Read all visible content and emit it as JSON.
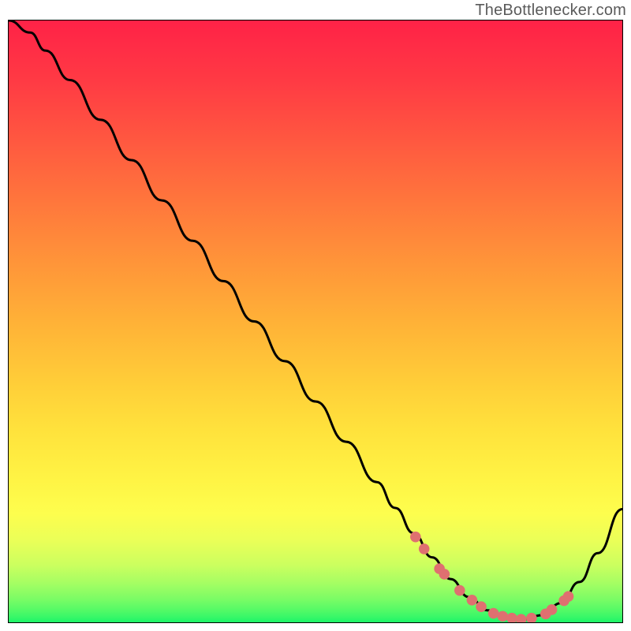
{
  "watermark": "TheBottlenecker.com",
  "gradient": {
    "stops": [
      {
        "offset": 0.0,
        "color": "#ff2247"
      },
      {
        "offset": 0.1,
        "color": "#ff3a44"
      },
      {
        "offset": 0.2,
        "color": "#ff5840"
      },
      {
        "offset": 0.3,
        "color": "#ff763c"
      },
      {
        "offset": 0.4,
        "color": "#ff9439"
      },
      {
        "offset": 0.5,
        "color": "#ffb137"
      },
      {
        "offset": 0.6,
        "color": "#ffcd38"
      },
      {
        "offset": 0.68,
        "color": "#ffe23c"
      },
      {
        "offset": 0.76,
        "color": "#fff344"
      },
      {
        "offset": 0.82,
        "color": "#fdfe4e"
      },
      {
        "offset": 0.865,
        "color": "#eaff58"
      },
      {
        "offset": 0.905,
        "color": "#cbff5f"
      },
      {
        "offset": 0.935,
        "color": "#a5fe63"
      },
      {
        "offset": 0.96,
        "color": "#7dfc65"
      },
      {
        "offset": 0.978,
        "color": "#58fa66"
      },
      {
        "offset": 0.992,
        "color": "#36f768"
      },
      {
        "offset": 1.0,
        "color": "#1cf468"
      }
    ]
  },
  "chart_data": {
    "type": "line",
    "title": "",
    "xlabel": "",
    "ylabel": "",
    "xlim": [
      0,
      100
    ],
    "ylim": [
      0,
      100
    ],
    "series": [
      {
        "name": "bottleneck-curve",
        "x": [
          0,
          3.5,
          6,
          10,
          15,
          20,
          25,
          30,
          35,
          40,
          45,
          50,
          55,
          60,
          63,
          66,
          69,
          72,
          75,
          78,
          81,
          84,
          87,
          90,
          93,
          96,
          100
        ],
        "y": [
          100,
          98.0,
          95.0,
          90.1,
          83.5,
          76.8,
          70.1,
          63.4,
          56.7,
          50.0,
          43.4,
          36.7,
          30.0,
          23.3,
          19.0,
          14.8,
          10.8,
          7.2,
          4.2,
          2.0,
          0.8,
          0.5,
          1.2,
          3.2,
          6.7,
          11.5,
          18.8
        ]
      }
    ],
    "markers": {
      "name": "optimum-points",
      "color": "#df7070",
      "points": [
        {
          "x": 66.3,
          "y": 14.2
        },
        {
          "x": 67.7,
          "y": 12.2
        },
        {
          "x": 70.2,
          "y": 8.9
        },
        {
          "x": 71.0,
          "y": 8.0
        },
        {
          "x": 73.5,
          "y": 5.3
        },
        {
          "x": 75.5,
          "y": 3.7
        },
        {
          "x": 77.0,
          "y": 2.6
        },
        {
          "x": 79.0,
          "y": 1.5
        },
        {
          "x": 80.5,
          "y": 1.0
        },
        {
          "x": 82.0,
          "y": 0.7
        },
        {
          "x": 83.5,
          "y": 0.5
        },
        {
          "x": 85.2,
          "y": 0.7
        },
        {
          "x": 87.5,
          "y": 1.4
        },
        {
          "x": 88.5,
          "y": 2.1
        },
        {
          "x": 90.5,
          "y": 3.6
        },
        {
          "x": 91.2,
          "y": 4.3
        }
      ]
    }
  }
}
